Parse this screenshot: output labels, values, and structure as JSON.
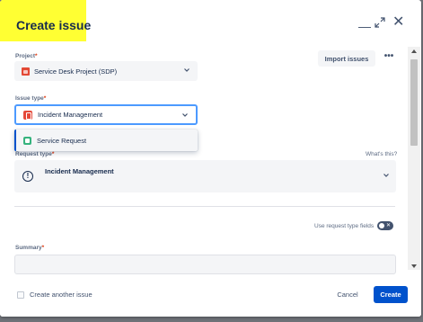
{
  "dialog": {
    "title": "Create issue",
    "minimize_glyph": "—",
    "collapse_glyph": "↗↙",
    "close_glyph": "✕"
  },
  "header_actions": {
    "import_label": "Import issues",
    "more_label": "•••"
  },
  "fields": {
    "project": {
      "label": "Project",
      "required_mark": "*",
      "value": "Service Desk Project (SDP)"
    },
    "issue_type": {
      "label": "Issue type",
      "required_mark": "*",
      "value": "Incident Management"
    },
    "issue_type_option": {
      "label": "Service Request"
    },
    "request_type": {
      "label": "Request type",
      "required_mark": "*",
      "value": "Incident Management",
      "help_link": "What's this?",
      "icon_glyph": "!"
    },
    "toggle": {
      "label": "Use request type fields",
      "glyph": "✕"
    },
    "summary": {
      "label": "Summary",
      "required_mark": "*",
      "value": ""
    }
  },
  "footer": {
    "create_another_label": "Create another issue",
    "cancel_label": "Cancel",
    "create_label": "Create"
  },
  "colors": {
    "primary": "#0052cc",
    "highlight": "#ffff33",
    "focus": "#4c9aff",
    "project_icon": "#e34935",
    "incident_icon": "#e5493a",
    "service_request_icon": "#36b37e"
  }
}
